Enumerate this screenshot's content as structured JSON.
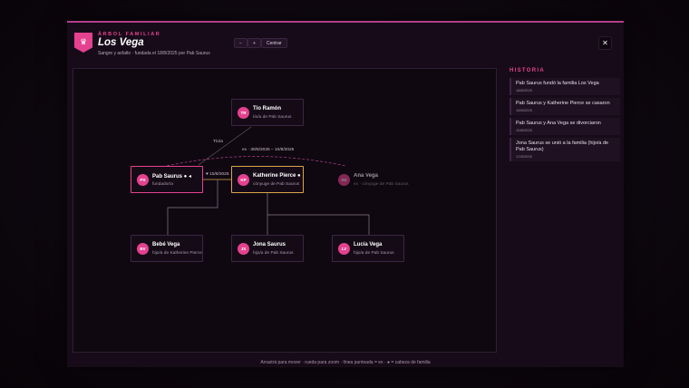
{
  "header": {
    "eyebrow": "ÁRBOL FAMILIAR",
    "title": "Los Vega",
    "subtitle": "Sangre y asfalto · fundada el 18/8/2025 por Pab Saurus",
    "logo_icon": "crown-icon"
  },
  "controls": {
    "zoom_out": "−",
    "zoom_in": "+",
    "center": "Centrar",
    "close": "✕"
  },
  "tree": {
    "members": [
      {
        "initials": "TR",
        "name": "Tío Ramón",
        "role": "tío/a de Pab Saurus"
      },
      {
        "initials": "PS",
        "name": "Pab Saurus ● ◂",
        "role": "fundador/a"
      },
      {
        "initials": "KP",
        "name": "Katherine Pierce ●",
        "role": "cónyuge de Pab Saurus"
      },
      {
        "initials": "AV",
        "name": "Ana Vega",
        "role": "ex · cónyuge de Pab Saurus"
      },
      {
        "initials": "BV",
        "name": "Bebé Vega",
        "role": "hijo/a de Katherine Pierce"
      },
      {
        "initials": "JS",
        "name": "Jona Saurus",
        "role": "hijo/a de Pab Saurus"
      },
      {
        "initials": "LV",
        "name": "Lucía Vega",
        "role": "hijo/a de Pab Saurus"
      }
    ],
    "link_labels": {
      "uncle": "Tío/a",
      "ex": "ex · 30/6/2025 – 10/8/2025",
      "marriage": "♥ 15/8/2025"
    }
  },
  "history": {
    "heading": "HISTORIA",
    "items": [
      {
        "text": "Pab Saurus fundó la familia Los Vega",
        "date": "18/8/2025"
      },
      {
        "text": "Pab Saurus y Katherine Pierce se casaron",
        "date": "15/8/2025"
      },
      {
        "text": "Pab Saurus y Ana Vega se divorciaron",
        "date": "10/8/2025"
      },
      {
        "text": "Jona Saurus se unió a la familia (hijo/a de Pab Saurus)",
        "date": "17/8/2025"
      }
    ]
  },
  "footer": "Arrastrá para mover · rueda para zoom · línea punteada = ex · ● = cabeza de familia",
  "colors": {
    "accent": "#e4418f",
    "selected": "#d9a64a",
    "background": "#170b19"
  }
}
